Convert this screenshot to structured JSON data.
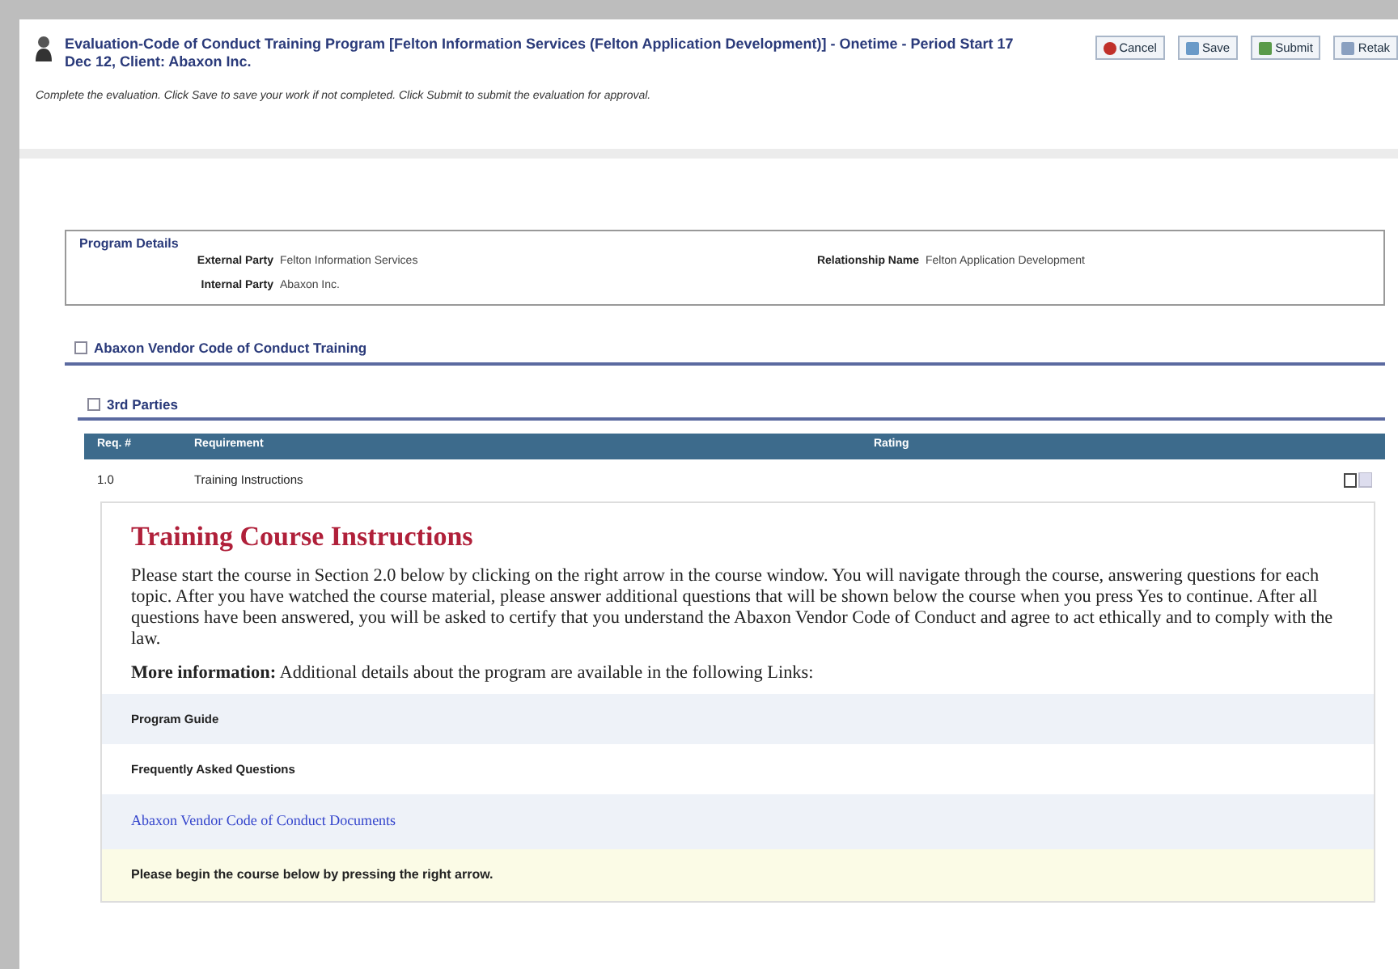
{
  "header": {
    "title": "Evaluation-Code of Conduct Training Program [Felton Information Services (Felton Application Development)] - Onetime - Period Start 17 Dec 12, Client: Abaxon Inc.",
    "instructions": "Complete the evaluation. Click Save to save your work if not completed. Click Submit to submit the evaluation for approval.",
    "buttons": [
      {
        "label": "Cancel",
        "kind": "cancel"
      },
      {
        "label": "Save",
        "kind": "save"
      },
      {
        "label": "Submit",
        "kind": "submit"
      },
      {
        "label": "Retak",
        "kind": "retake"
      }
    ]
  },
  "program_details": {
    "legend": "Program Details",
    "fields": [
      {
        "label": "External Party",
        "value": "Felton Information Services"
      },
      {
        "label": "Relationship Name",
        "value": "Felton Application Development"
      },
      {
        "label": "Internal Party",
        "value": "Abaxon Inc."
      }
    ]
  },
  "section": {
    "title": "Abaxon Vendor Code of Conduct Training",
    "expanded": true
  },
  "subsection": {
    "title": "3rd Parties",
    "expanded": true
  },
  "table": {
    "columns": [
      "Req. #",
      "Requirement",
      "Rating"
    ],
    "rows": [
      {
        "req": "1.0",
        "requirement": "Training Instructions"
      }
    ]
  },
  "instructions_box": {
    "heading": "Training Course Instructions",
    "paragraph": "Please start the course in Section 2.0 below by clicking on the right arrow in the course window.  You will navigate through the course, answering questions for each topic.  After you have watched the course material, please answer additional questions that will be shown below the course when you press Yes to continue.  After all questions have been answered, you will be asked to certify that you understand the Abaxon Vendor Code of Conduct and agree to act ethically and to comply with the law.",
    "more_info": "**More information:**  Additional details about the program are available in the following Links:",
    "links": [
      {
        "text": "Program Guide",
        "kind": "bold"
      },
      {
        "text": "Frequently Asked Questions",
        "kind": "bold"
      },
      {
        "text": "Abaxon Vendor Code of Conduct Documents",
        "kind": "link"
      },
      {
        "text": "Please begin the course below by pressing the right arrow.",
        "kind": "note"
      }
    ]
  }
}
